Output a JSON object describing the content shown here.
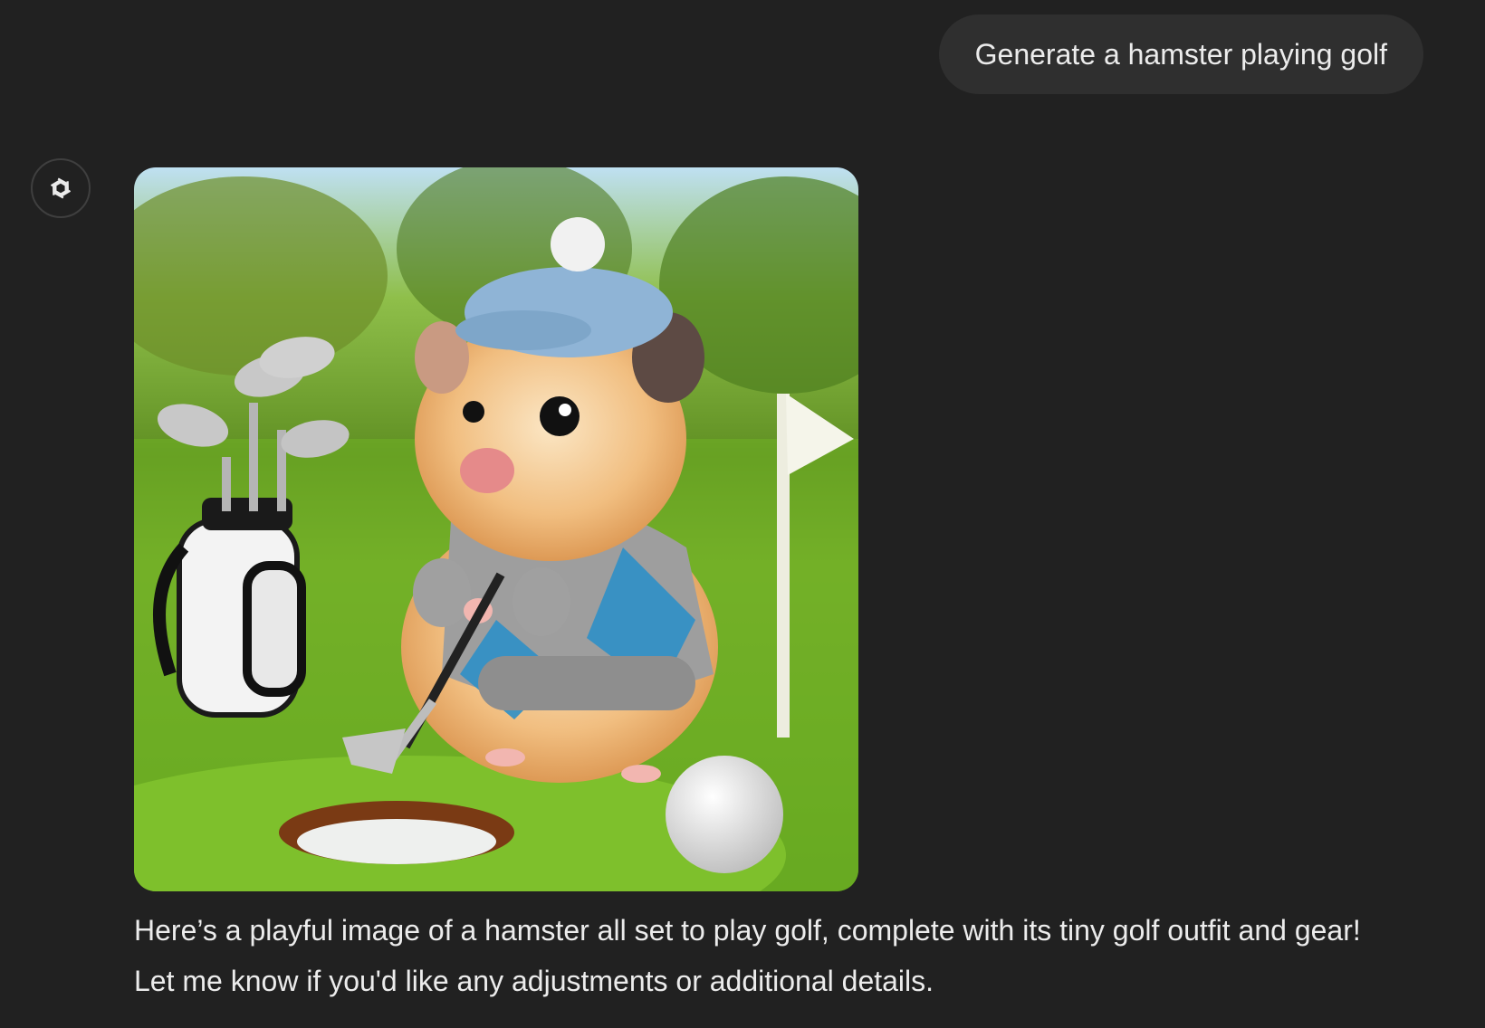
{
  "conversation": {
    "user_message": "Generate a hamster playing golf",
    "assistant": {
      "avatar_icon": "openai-logo-icon",
      "image_subject": "hamster-playing-golf",
      "response_line_1": "Here’s a playful image of a hamster all set to play golf, complete with its tiny golf outfit and gear!",
      "response_line_2": "Let me know if you'd like any adjustments or additional details."
    }
  },
  "colors": {
    "background": "#212121",
    "user_bubble": "#2f2f2f",
    "text": "#ececec"
  }
}
